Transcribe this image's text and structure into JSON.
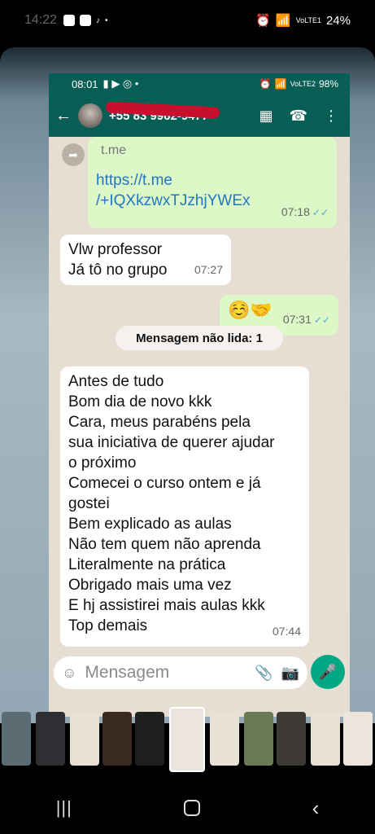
{
  "outer_status": {
    "time": "14:22",
    "battery": "24%",
    "network": "VoLTE1"
  },
  "inner_status": {
    "time": "08:01",
    "battery": "98%",
    "network": "VoLTE2"
  },
  "header": {
    "contact": "+55 83 9962-9477"
  },
  "messages": [
    {
      "dir": "out",
      "preview": "t.me",
      "link": "https://t.me\n/+IQXkzwxTJzhjYWEx",
      "time": "07:18"
    },
    {
      "dir": "in",
      "text": "Vlw professor\nJá tô no grupo",
      "time": "07:27"
    },
    {
      "dir": "out",
      "text": "☺️🤝",
      "time": "07:31"
    },
    {
      "dir": "in",
      "text": "Antes de tudo\nBom dia de novo kkk\nCara, meus parabéns pela\nsua iniciativa de querer ajudar\no próximo\nComecei o curso ontem e já\ngostei\nBem explicado as aulas\nNão tem quem não aprenda\nLiteralmente na prática\nObrigado mais uma vez\nE hj assistirei mais aulas kkk\nTop demais",
      "time": "07:44"
    }
  ],
  "unread_label": "Mensagem não lida: 1",
  "composer": {
    "placeholder": "Mensagem"
  },
  "colors": {
    "header": "#075e54",
    "outgoing_bubble": "#dcf8c6",
    "mic": "#00a884",
    "read_ticks": "#4fa3e0"
  },
  "icons": [
    "back-arrow-icon",
    "store-icon",
    "call-add-icon",
    "more-vert-icon",
    "forward-icon",
    "emoji-icon",
    "attach-icon",
    "camera-icon",
    "mic-icon",
    "recent-apps-icon",
    "home-icon",
    "back-icon"
  ]
}
